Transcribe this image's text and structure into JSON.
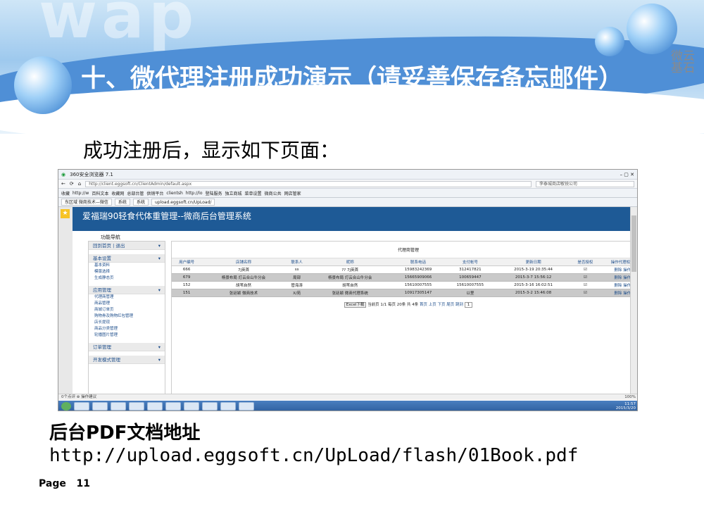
{
  "slide": {
    "title": "十、微代理注册成功演示（请妥善保存备忘邮件）",
    "logo_text": "微云基石",
    "subtitle": "成功注册后，显示如下页面：",
    "pdf_label": "后台PDF文档地址",
    "pdf_url": "http://upload.eggsoft.cn/UpLoad/flash/01Book.pdf",
    "page_label": "Page",
    "page_number": "11"
  },
  "browser": {
    "name": "360安全浏览器 7.1",
    "url": "http://client.eggsoft.cn/ClientAdmin/default.aspx",
    "search_placeholder": "李泰城商店敏锐公司",
    "bookmarks": [
      "收藏",
      "http://w",
      "百科文本",
      "收藏网",
      "总部台管",
      "供销平台",
      "clientsh",
      "http://lo",
      "登陆服务",
      "独立商城",
      "菜单设置",
      "微商公共",
      "网店管家"
    ],
    "tabs": [
      "东区域 微商技术—微信",
      "系统",
      "系统",
      "upload.eggsoft.cn/UpLoad/"
    ]
  },
  "app": {
    "header": "爱福瑞90轻食代体重管理--微商后台管理系统",
    "nav_label": "功能导航",
    "sidebar": {
      "top_link": "回到首页 | 退出",
      "sections": [
        {
          "title": "基本设置",
          "items": [
            "基本资料",
            "模版选择",
            "生成静态页"
          ]
        },
        {
          "title": "应用管理",
          "items": [
            "代理商管理",
            "商品管理",
            "商城订单页",
            "购物券及购物红包管理",
            "店长提现",
            "商品分类管理",
            "轮播图片管理"
          ]
        },
        {
          "title": "订单管理",
          "items": []
        },
        {
          "title": "开发模式管理",
          "items": []
        }
      ]
    },
    "main": {
      "title": "代理商管理",
      "columns": [
        "用户编号",
        "店铺名称",
        "联系人",
        "昵称",
        "联系电话",
        "支付帐号",
        "更新日期",
        "是否授权",
        "操作代理权限"
      ],
      "rows": [
        {
          "cells": [
            "666",
            "7J英首",
            "ss",
            "?? 7J英首",
            "15983242369",
            "312417821",
            "2015-3-19 20:35:44",
            "☑",
            "删除 操作"
          ],
          "shade": false
        },
        {
          "cells": [
            "679",
            "杨景布局 灯云合山牛分会",
            "局部",
            "杨景布局 灯云合山牛分会",
            "15665909066",
            "100659447",
            "2015-3-7 15:56:12",
            "☑",
            "删除 操作"
          ],
          "shade": true
        },
        {
          "cells": [
            "152",
            "胡苇自然",
            "管海涛",
            "胡苇自然",
            "15610007555",
            "15610007555",
            "2015-3-16 16:02:51",
            "☑",
            "删除 操作"
          ],
          "shade": false
        },
        {
          "cells": [
            "151",
            "张廷颖 微商技术",
            "X/苑",
            "张廷颖 微商代理系统",
            "10917305147",
            "以里",
            "2015-3-2 15:46:08",
            "☑",
            "删除 操作"
          ],
          "shade": true
        }
      ],
      "pager": {
        "excel": "Excel下载",
        "info": "当前页 1/1 每页 20条 共 4条",
        "links": "首页 上页 下页 尾页 跳到",
        "page": "1"
      }
    }
  },
  "statusbar": {
    "left": "0个点评   ⊕ 操作建议",
    "right": "100%"
  },
  "taskbar": {
    "clock": "11:57",
    "date": "2015/3/20"
  }
}
